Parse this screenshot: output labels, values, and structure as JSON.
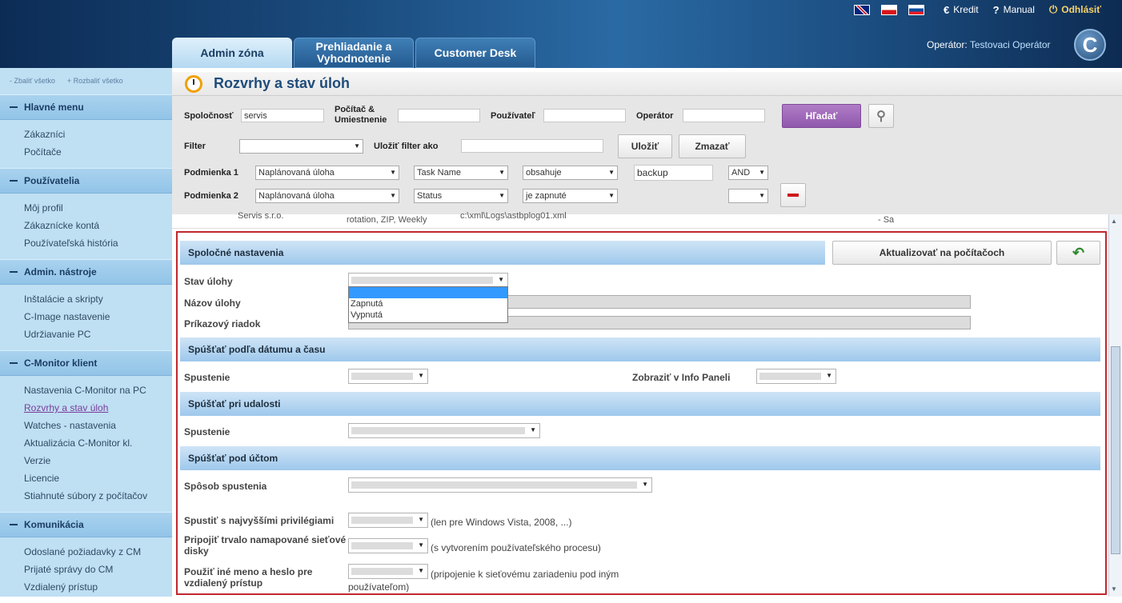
{
  "header": {
    "kredit": "Kredit",
    "manual": "Manual",
    "logout": "Odhlásiť",
    "operator_label": "Operátor:",
    "operator_name": "Testovaci Operátor",
    "logo": "C",
    "tabs": [
      {
        "label": "Admin zóna"
      },
      {
        "label": "Prehliadanie a Vyhodnotenie"
      },
      {
        "label": "Customer Desk"
      }
    ]
  },
  "sidebar": {
    "collapse_all": "- Zbaliť všetko",
    "expand_all": "+ Rozbaliť všetko",
    "sections": [
      {
        "title": "Hlavné menu",
        "items": [
          "Zákazníci",
          "Počítače"
        ]
      },
      {
        "title": "Používatelia",
        "items": [
          "Môj profil",
          "Zákaznícke kontá",
          "Používateľská história"
        ]
      },
      {
        "title": "Admin. nástroje",
        "items": [
          "Inštalácie a skripty",
          "C-Image nastavenie",
          "Udržiavanie PC"
        ]
      },
      {
        "title": "C-Monitor klient",
        "items": [
          "Nastavenia C-Monitor na PC",
          "Rozvrhy a stav úloh",
          "Watches - nastavenia",
          "Aktualizácia C-Monitor kl.",
          "Verzie",
          "Licencie",
          "Stiahnuté súbory z počítačov"
        ]
      },
      {
        "title": "Komunikácia",
        "items": [
          "Odoslané požiadavky z CM",
          "Prijaté správy do CM",
          "Vzdialený prístup"
        ]
      }
    ]
  },
  "page": {
    "title": "Rozvrhy a stav úloh"
  },
  "filter": {
    "spolocnost": "Spoločnosť",
    "spolocnost_value": "servis",
    "pocitac": "Počítač & Umiestnenie",
    "pouzivatel": "Používateľ",
    "operator": "Operátor",
    "search": "Hľadať",
    "filter": "Filter",
    "save_as": "Uložiť filter ako",
    "save": "Uložiť",
    "clear": "Zmazať",
    "cond1": {
      "label": "Podmienka 1",
      "field": "Naplánovaná úloha",
      "sub": "Task Name",
      "op": "obsahuje",
      "value": "backup",
      "logic": "AND"
    },
    "cond2": {
      "label": "Podmienka 2",
      "field": "Naplánovaná úloha",
      "sub": "Status",
      "op": "je zapnuté",
      "logic": ""
    }
  },
  "strip": {
    "a": "Servis s.r.o.",
    "b": "rotation, ZIP, Weekly",
    "c": "c:\\xml\\Logs\\astbplog01.xml",
    "d": "- Sa"
  },
  "panel": {
    "common": "Spoločné nastavenia",
    "update": "Aktualizovať na počítačoch",
    "stav": "Stav úlohy",
    "nazov": "Názov úlohy",
    "prikaz": "Príkazový riadok",
    "dropdown": [
      "",
      "Zapnutá",
      "Vypnutá"
    ],
    "by_date": "Spúšťať podľa dátumu a času",
    "spustenie": "Spustenie",
    "infopanel": "Zobraziť v Info Paneli",
    "by_event": "Spúšťať pri udalosti",
    "spustenie2": "Spustenie",
    "by_account": "Spúšťať pod účtom",
    "sposob": "Spôsob spustenia",
    "priv": "Spustiť s najvyššími privilégiami",
    "priv_note": "(len pre Windows Vista, 2008, ...)",
    "map": "Pripojiť trvalo namapované sieťové disky",
    "map_note": "(s vytvorením používateľského procesu)",
    "cred": "Použiť iné meno a heslo pre vzdialený prístup",
    "cred_note": "(pripojenie k sieťovému zariadeniu pod iným používateľom)"
  }
}
